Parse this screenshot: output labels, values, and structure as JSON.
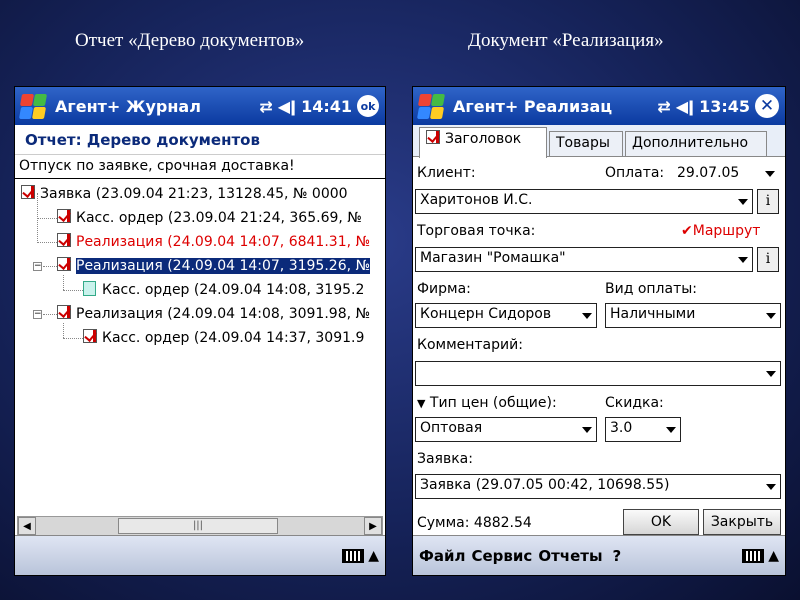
{
  "captions": {
    "left": "Отчет «Дерево документов»",
    "right": "Документ «Реализация»"
  },
  "left_device": {
    "title": "Агент+ Журнал",
    "time": "14:41",
    "ok_label": "ok",
    "report_header": "Отчет: Дерево документов",
    "filter": "Отпуск по заявке, срочная доставка!",
    "tree_rows": [
      {
        "text": "Заявка (23.09.04 21:23, 13128.45, № 0000",
        "icon": "checked-doc-icon"
      },
      {
        "text": "Касс. ордер (23.09.04 21:24, 365.69, №",
        "icon": "checked-doc-icon"
      },
      {
        "text": "Реализация (24.09.04 14:07, 6841.31, №",
        "icon": "checked-doc-icon",
        "color": "#d00000"
      },
      {
        "text": "Реализация (24.09.04 14:07, 3195.26, №",
        "icon": "checked-doc-icon",
        "selected": true
      },
      {
        "text": "Касс. ордер (24.09.04 14:08, 3195.2",
        "icon": "doc-icon"
      },
      {
        "text": "Реализация (24.09.04 14:08, 3091.98, №",
        "icon": "checked-doc-icon"
      },
      {
        "text": "Касс. ордер (24.09.04 14:37, 3091.9",
        "icon": "checked-doc-icon"
      }
    ],
    "menu": []
  },
  "right_device": {
    "title": "Агент+ Реализац",
    "time": "13:45",
    "tabs": [
      "Заголовок",
      "Товары",
      "Дополнительно"
    ],
    "client_label": "Клиент:",
    "payment_label": "Оплата:",
    "payment_date": "29.07.05",
    "client_value": "Харитонов И.С.",
    "outlet_label": "Торговая точка:",
    "route_label": "Маршрут",
    "outlet_value": "Магазин \"Ромашка\"",
    "firm_label": "Фирма:",
    "pay_type_label": "Вид оплаты:",
    "firm_value": "Концерн Сидоров",
    "pay_type_value": "Наличными",
    "comment_label": "Комментарий:",
    "comment_value": "",
    "price_type_label": "Тип цен (общие):",
    "discount_label": "Скидка:",
    "price_type_value": "Оптовая",
    "discount_value": "3.0",
    "order_label": "Заявка:",
    "order_value": "Заявка (29.07.05 00:42, 10698.55)",
    "sum_label": "Сумма: 4882.54",
    "ok_button": "OK",
    "close_button": "Закрыть",
    "menu": [
      "Файл",
      "Сервис",
      "Отчеты",
      "?"
    ],
    "info_glyph": "i"
  },
  "colors": {
    "titlebar": "#0b3aa0",
    "selection": "#0b2a7a",
    "highlight_text": "#d00000"
  }
}
